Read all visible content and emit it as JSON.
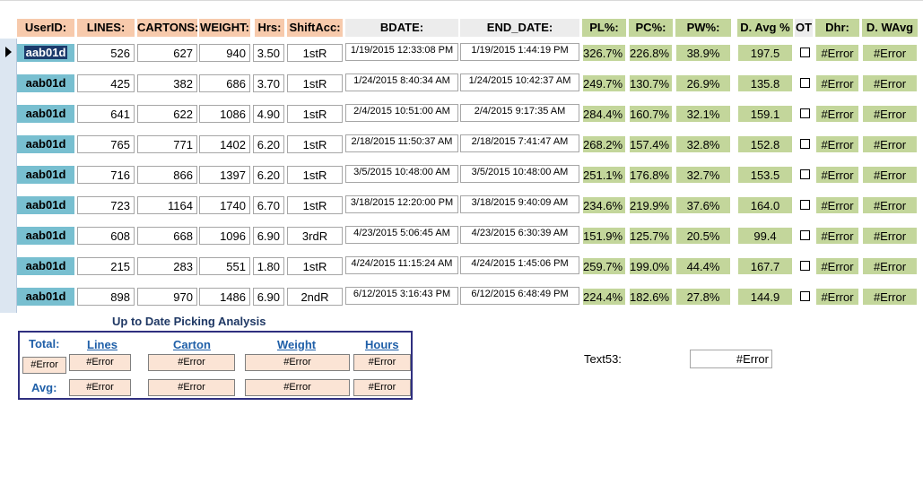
{
  "headers": {
    "userid": "UserID:",
    "lines": "LINES:",
    "cartons": "CARTONS:",
    "weight": "WEIGHT:",
    "hrs": "Hrs:",
    "shiftacc": "ShiftAcc:",
    "bdate": "BDATE:",
    "end_date": "END_DATE:",
    "pl": "PL%:",
    "pc": "PC%:",
    "pw": "PW%:",
    "davg": "D. Avg %",
    "ot": "OT",
    "dhr": "Dhr:",
    "dwavg": "D. WAvg"
  },
  "rows": [
    {
      "userid": "aab01d",
      "lines": "526",
      "cartons": "627",
      "weight": "940",
      "hrs": "3.50",
      "shift": "1stR",
      "bdate": "1/19/2015 12:33:08 PM",
      "end_date": "1/19/2015 1:44:19 PM",
      "pl": "326.7%",
      "pc": "226.8%",
      "pw": "38.9%",
      "davg": "197.5",
      "dhr": "#Error",
      "dwavg": "#Error"
    },
    {
      "userid": "aab01d",
      "lines": "425",
      "cartons": "382",
      "weight": "686",
      "hrs": "3.70",
      "shift": "1stR",
      "bdate": "1/24/2015 8:40:34 AM",
      "end_date": "1/24/2015 10:42:37 AM",
      "pl": "249.7%",
      "pc": "130.7%",
      "pw": "26.9%",
      "davg": "135.8",
      "dhr": "#Error",
      "dwavg": "#Error"
    },
    {
      "userid": "aab01d",
      "lines": "641",
      "cartons": "622",
      "weight": "1086",
      "hrs": "4.90",
      "shift": "1stR",
      "bdate": "2/4/2015 10:51:00 AM",
      "end_date": "2/4/2015 9:17:35 AM",
      "pl": "284.4%",
      "pc": "160.7%",
      "pw": "32.1%",
      "davg": "159.1",
      "dhr": "#Error",
      "dwavg": "#Error"
    },
    {
      "userid": "aab01d",
      "lines": "765",
      "cartons": "771",
      "weight": "1402",
      "hrs": "6.20",
      "shift": "1stR",
      "bdate": "2/18/2015 11:50:37 AM",
      "end_date": "2/18/2015 7:41:47 AM",
      "pl": "268.2%",
      "pc": "157.4%",
      "pw": "32.8%",
      "davg": "152.8",
      "dhr": "#Error",
      "dwavg": "#Error"
    },
    {
      "userid": "aab01d",
      "lines": "716",
      "cartons": "866",
      "weight": "1397",
      "hrs": "6.20",
      "shift": "1stR",
      "bdate": "3/5/2015 10:48:00 AM",
      "end_date": "3/5/2015 10:48:00 AM",
      "pl": "251.1%",
      "pc": "176.8%",
      "pw": "32.7%",
      "davg": "153.5",
      "dhr": "#Error",
      "dwavg": "#Error"
    },
    {
      "userid": "aab01d",
      "lines": "723",
      "cartons": "1164",
      "weight": "1740",
      "hrs": "6.70",
      "shift": "1stR",
      "bdate": "3/18/2015 12:20:00 PM",
      "end_date": "3/18/2015 9:40:09 AM",
      "pl": "234.6%",
      "pc": "219.9%",
      "pw": "37.6%",
      "davg": "164.0",
      "dhr": "#Error",
      "dwavg": "#Error"
    },
    {
      "userid": "aab01d",
      "lines": "608",
      "cartons": "668",
      "weight": "1096",
      "hrs": "6.90",
      "shift": "3rdR",
      "bdate": "4/23/2015 5:06:45 AM",
      "end_date": "4/23/2015 6:30:39 AM",
      "pl": "151.9%",
      "pc": "125.7%",
      "pw": "20.5%",
      "davg": "99.4",
      "dhr": "#Error",
      "dwavg": "#Error"
    },
    {
      "userid": "aab01d",
      "lines": "215",
      "cartons": "283",
      "weight": "551",
      "hrs": "1.80",
      "shift": "1stR",
      "bdate": "4/24/2015 11:15:24 AM",
      "end_date": "4/24/2015 1:45:06 PM",
      "pl": "259.7%",
      "pc": "199.0%",
      "pw": "44.4%",
      "davg": "167.7",
      "dhr": "#Error",
      "dwavg": "#Error"
    },
    {
      "userid": "aab01d",
      "lines": "898",
      "cartons": "970",
      "weight": "1486",
      "hrs": "6.90",
      "shift": "2ndR",
      "bdate": "6/12/2015 3:16:43 PM",
      "end_date": "6/12/2015 6:48:49 PM",
      "pl": "224.4%",
      "pc": "182.6%",
      "pw": "27.8%",
      "davg": "144.9",
      "dhr": "#Error",
      "dwavg": "#Error"
    }
  ],
  "summary": {
    "title": "Up to Date Picking Analysis",
    "total_label": "Total:",
    "avg_label": "Avg:",
    "col_lines": "Lines",
    "col_carton": "Carton",
    "col_weight": "Weight",
    "col_hours": "Hours",
    "total_first": "#Error",
    "total_lines": "#Error",
    "total_carton": "#Error",
    "total_weight": "#Error",
    "total_hours": "#Error",
    "avg_lines": "#Error",
    "avg_carton": "#Error",
    "avg_weight": "#Error",
    "avg_hours": "#Error"
  },
  "text53": {
    "label": "Text53:",
    "value": "#Error"
  },
  "colors": {
    "header_peach": "#f7caac",
    "header_green": "#c3d69b",
    "userid_blue": "#78bfd0",
    "summary_blue": "#1f5fa8",
    "summary_field": "#fbe4d5"
  }
}
